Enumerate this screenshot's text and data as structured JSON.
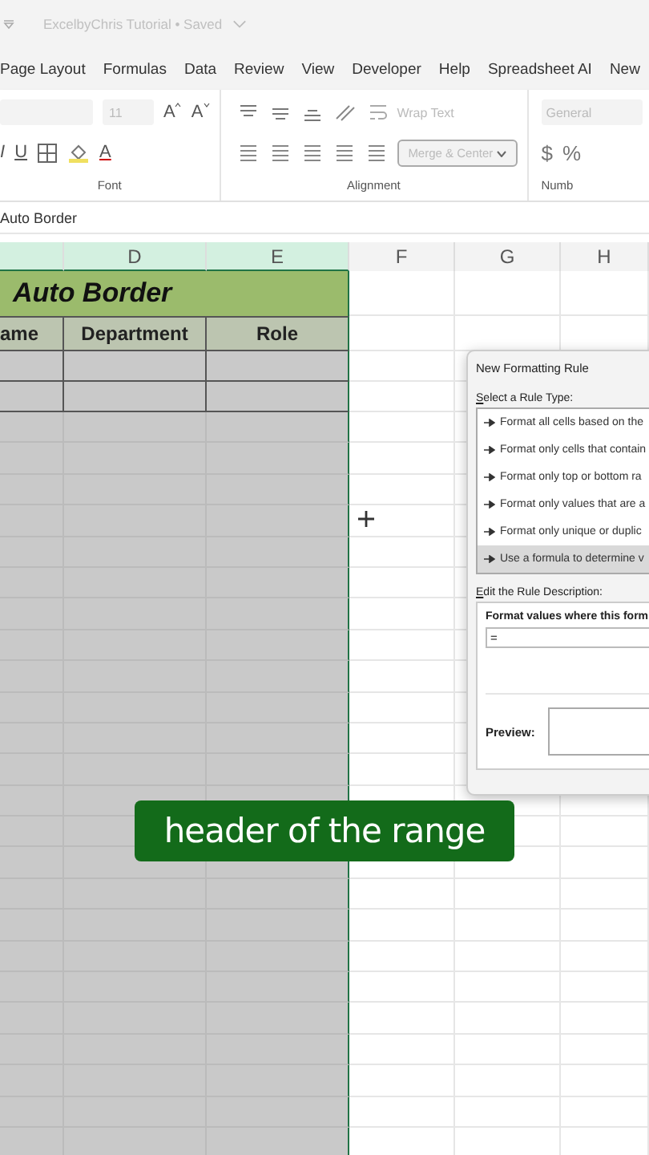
{
  "title_bar": {
    "title": "ExcelbyChris Tutorial • Saved"
  },
  "tabs": [
    {
      "label": "Page Layout",
      "selected": false
    },
    {
      "label": "Formulas",
      "selected": false
    },
    {
      "label": "Data",
      "selected": false
    },
    {
      "label": "Review",
      "selected": false
    },
    {
      "label": "View",
      "selected": false
    },
    {
      "label": "Developer",
      "selected": false
    },
    {
      "label": "Help",
      "selected": false
    },
    {
      "label": "Spreadsheet AI",
      "selected": false
    },
    {
      "label": "New",
      "selected": false
    }
  ],
  "ribbon": {
    "font_size": "11",
    "grow_font": "A",
    "shrink_font": "A",
    "italic": "I",
    "underline": "U",
    "font_color": "A",
    "font_group": "Font",
    "wrap_text": "Wrap Text",
    "merge_center": "Merge & Center",
    "alignment_group": "Alignment",
    "number_format": "General",
    "currency": "$",
    "percent": "%",
    "number_group": "Numb"
  },
  "formula_bar": {
    "value": "Auto Border"
  },
  "columns": [
    {
      "selected": true
    },
    {
      "label": "D",
      "selected": true
    },
    {
      "label": "E",
      "selected": true
    },
    {
      "label": "F",
      "selected": false
    },
    {
      "label": "G",
      "selected": false
    },
    {
      "label": "H",
      "selected": false
    }
  ],
  "table": {
    "title": "Auto Border",
    "headers": [
      "ame",
      "Department",
      "Role"
    ]
  },
  "dialog": {
    "title": "New Formatting Rule",
    "rule_type_label": "Select a Rule Type:",
    "rule_types": [
      {
        "label": "Format all cells based on the",
        "selected": false
      },
      {
        "label": "Format only cells that contain",
        "selected": false
      },
      {
        "label": "Format only top or bottom ra",
        "selected": false
      },
      {
        "label": "Format only values that are a",
        "selected": false
      },
      {
        "label": "Format only unique or duplic",
        "selected": false
      },
      {
        "label": "Use a formula to determine v",
        "selected": true
      }
    ],
    "description_label": "Edit the Rule Description:",
    "formula_label": "Format values where this form",
    "formula_value": "=",
    "preview_label": "Preview:"
  },
  "caption": "header of the range"
}
